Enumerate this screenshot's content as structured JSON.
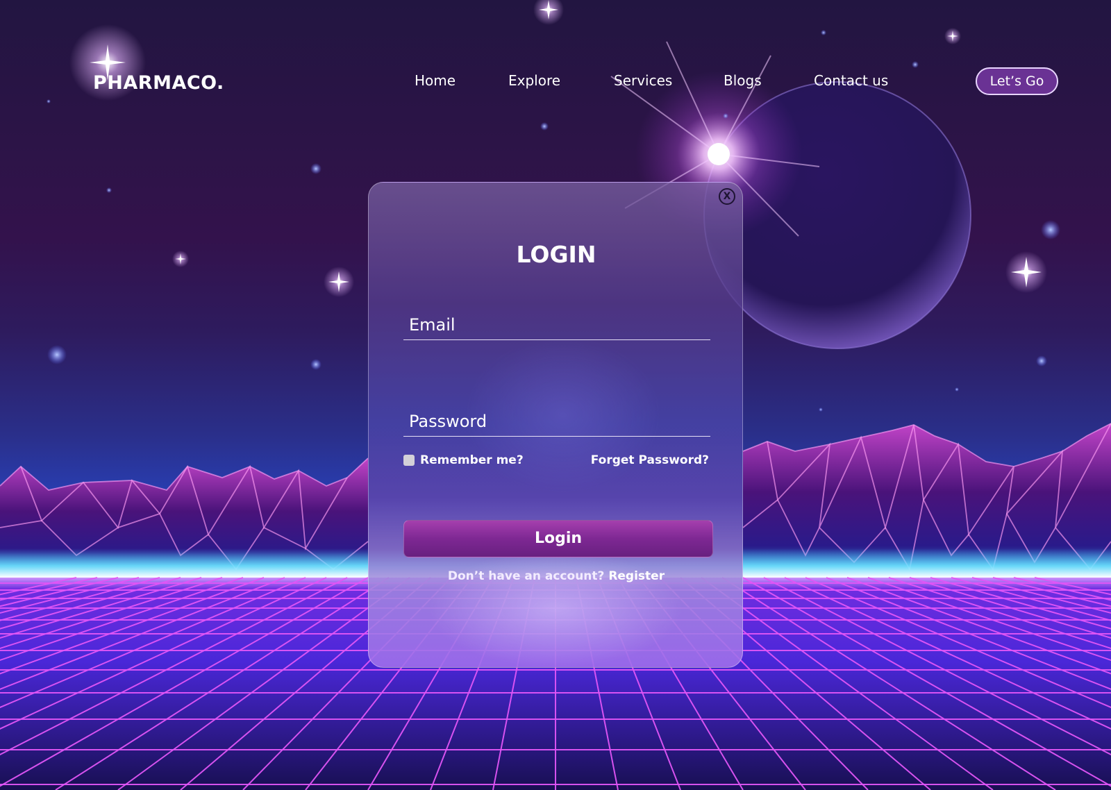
{
  "header": {
    "logo": "PHARMACO.",
    "nav": [
      "Home",
      "Explore",
      "Services",
      "Blogs",
      "Contact us"
    ],
    "cta_label": "Let’s Go"
  },
  "login": {
    "close_label": "X",
    "title": "LOGIN",
    "email_placeholder": "Email",
    "email_value": "",
    "password_placeholder": "Password",
    "password_value": "",
    "remember_label": "Remember me?",
    "remember_checked": false,
    "forgot_label": "Forget Password?",
    "submit_label": "Login",
    "signup_prompt": "Don’t have an account?",
    "register_label": "Register"
  },
  "icons": {
    "close": "close-icon",
    "checkbox": "checkbox-icon"
  },
  "colors": {
    "accent": "#7e2893",
    "cta_bg": "#6a3294",
    "grid_line": "#d44bf0",
    "horizon_glow": "#7fe6ff",
    "text": "#ffffff"
  }
}
